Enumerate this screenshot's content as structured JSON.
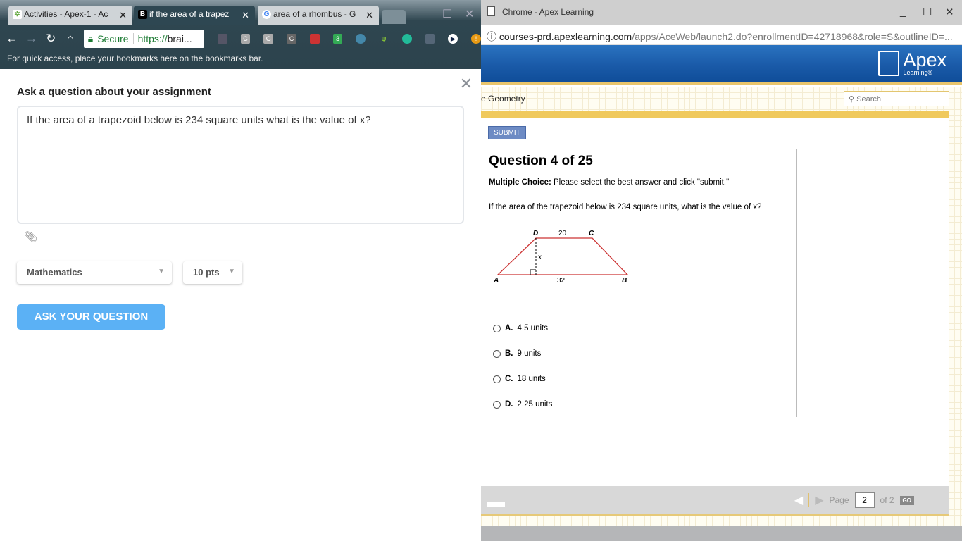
{
  "left_browser": {
    "tabs": [
      {
        "label": "Activities - Apex-1 - Ac",
        "favicon": "apex"
      },
      {
        "label": "if the area of a trapez",
        "favicon": "B"
      },
      {
        "label": "area of a rhombus - G",
        "favicon": "G"
      }
    ],
    "omnibox": {
      "secure": "Secure",
      "url_prefix": "https://",
      "url_rest": "brai..."
    },
    "extensions": [
      "C",
      "G",
      "C"
    ],
    "ext_badge": "3",
    "bookmarks_hint": "For quick access, place your bookmarks here on the bookmarks bar."
  },
  "ask_panel": {
    "title": "Ask a question about your assignment",
    "question": "If the area of a trapezoid below is 234 square units what is the value of x?",
    "subject": "Mathematics",
    "points": "10 pts",
    "ask_button": "ASK YOUR QUESTION"
  },
  "right_browser": {
    "window_title": "Chrome - Apex Learning",
    "url_host": "courses-prd.apexlearning.com",
    "url_path": "/apps/AceWeb/launch2.do?enrollmentID=42718968&role=S&outlineID=...",
    "logo_main": "Apex",
    "logo_sub": "Learning®",
    "course": "e Geometry",
    "search_placeholder": "Search",
    "submit": "SUBMIT",
    "question_number": "Question 4 of 25",
    "mc_label": "Multiple Choice:",
    "mc_instruction": " Please select the best answer and click \"submit.\"",
    "question_text": "If the area of the trapezoid below is 234 square units, what is the value of x?",
    "figure": {
      "D": "D",
      "C": "C",
      "A": "A",
      "B": "B",
      "top": "20",
      "bottom": "32",
      "height": "x"
    },
    "options": [
      {
        "letter": "A.",
        "text": "4.5 units"
      },
      {
        "letter": "B.",
        "text": "9 units"
      },
      {
        "letter": "C.",
        "text": "18 units"
      },
      {
        "letter": "D.",
        "text": "2.25 units"
      }
    ],
    "pager": {
      "label": "Page",
      "value": "2",
      "of": "of 2",
      "go": "GO"
    }
  }
}
